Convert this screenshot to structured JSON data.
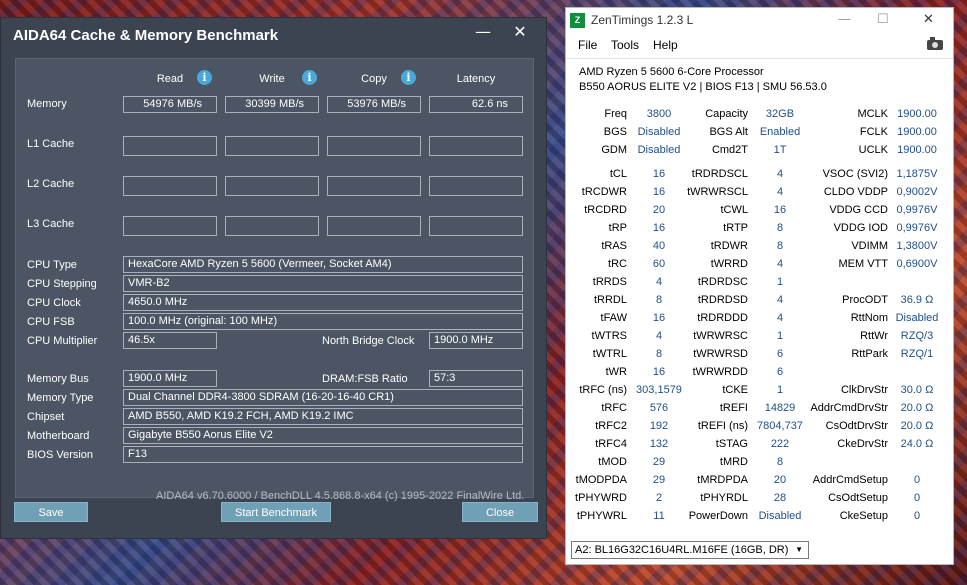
{
  "aida": {
    "title": "AIDA64 Cache & Memory Benchmark",
    "minimize_glyph": "—",
    "close_glyph": "✕",
    "columns": {
      "read": "Read",
      "write": "Write",
      "copy": "Copy",
      "latency": "Latency"
    },
    "info_glyph": "i",
    "rows": [
      {
        "label": "Memory",
        "read": "54976 MB/s",
        "write": "30399 MB/s",
        "copy": "53976 MB/s",
        "latency": "62.6 ns"
      },
      {
        "label": "L1 Cache",
        "read": "",
        "write": "",
        "copy": "",
        "latency": ""
      },
      {
        "label": "L2 Cache",
        "read": "",
        "write": "",
        "copy": "",
        "latency": ""
      },
      {
        "label": "L3 Cache",
        "read": "",
        "write": "",
        "copy": "",
        "latency": ""
      }
    ],
    "cpu": {
      "type_label": "CPU Type",
      "type": "HexaCore AMD Ryzen 5 5600  (Vermeer, Socket AM4)",
      "stepping_label": "CPU Stepping",
      "stepping": "VMR-B2",
      "clock_label": "CPU Clock",
      "clock": "4650.0 MHz",
      "fsb_label": "CPU FSB",
      "fsb": "100.0 MHz  (original: 100 MHz)",
      "mult_label": "CPU Multiplier",
      "mult": "46.5x",
      "nb_label": "North Bridge Clock",
      "nb": "1900.0 MHz"
    },
    "mem": {
      "bus_label": "Memory Bus",
      "bus": "1900.0 MHz",
      "ratio_label": "DRAM:FSB Ratio",
      "ratio": "57:3",
      "type_label": "Memory Type",
      "type": "Dual Channel DDR4-3800 SDRAM  (16-20-16-40 CR1)",
      "chipset_label": "Chipset",
      "chipset": "AMD B550, AMD K19.2 FCH, AMD K19.2 IMC",
      "mobo_label": "Motherboard",
      "mobo": "Gigabyte B550 Aorus Elite V2",
      "bios_label": "BIOS Version",
      "bios": "F13"
    },
    "footer": "AIDA64 v6.70.6000 / BenchDLL 4.5.868.8-x64  (c) 1995-2022 FinalWire Ltd.",
    "buttons": {
      "save": "Save",
      "start": "Start Benchmark",
      "close": "Close"
    }
  },
  "zen": {
    "title": "ZenTimings 1.2.3 L",
    "logo": "Z",
    "menu": {
      "file": "File",
      "tools": "Tools",
      "help": "Help"
    },
    "cpu": "AMD Ryzen 5 5600 6-Core Processor",
    "board": "B550 AORUS ELITE V2 | BIOS F13 | SMU 56.53.0",
    "top": [
      {
        "k1": "Freq",
        "v1": "3800",
        "k2": "Capacity",
        "v2": "32GB",
        "k3": "MCLK",
        "v3": "1900.00"
      },
      {
        "k1": "BGS",
        "v1": "Disabled",
        "k2": "BGS Alt",
        "v2": "Enabled",
        "k3": "FCLK",
        "v3": "1900.00"
      },
      {
        "k1": "GDM",
        "v1": "Disabled",
        "k2": "Cmd2T",
        "v2": "1T",
        "k3": "UCLK",
        "v3": "1900.00"
      }
    ],
    "timings": [
      {
        "k1": "tCL",
        "v1": "16",
        "k2": "tRDRDSCL",
        "v2": "4",
        "k3": "VSOC (SVI2)",
        "v3": "1,1875V"
      },
      {
        "k1": "tRCDWR",
        "v1": "16",
        "k2": "tWRWRSCL",
        "v2": "4",
        "k3": "CLDO VDDP",
        "v3": "0,9002V"
      },
      {
        "k1": "tRCDRD",
        "v1": "20",
        "k2": "tCWL",
        "v2": "16",
        "k3": "VDDG CCD",
        "v3": "0,9976V"
      },
      {
        "k1": "tRP",
        "v1": "16",
        "k2": "tRTP",
        "v2": "8",
        "k3": "VDDG IOD",
        "v3": "0,9976V"
      },
      {
        "k1": "tRAS",
        "v1": "40",
        "k2": "tRDWR",
        "v2": "8",
        "k3": "VDIMM",
        "v3": "1,3800V"
      },
      {
        "k1": "tRC",
        "v1": "60",
        "k2": "tWRRD",
        "v2": "4",
        "k3": "MEM VTT",
        "v3": "0,6900V"
      },
      {
        "k1": "tRRDS",
        "v1": "4",
        "k2": "tRDRDSC",
        "v2": "1",
        "k3": "",
        "v3": ""
      },
      {
        "k1": "tRRDL",
        "v1": "8",
        "k2": "tRDRDSD",
        "v2": "4",
        "k3": "ProcODT",
        "v3": "36.9 Ω"
      },
      {
        "k1": "tFAW",
        "v1": "16",
        "k2": "tRDRDDD",
        "v2": "4",
        "k3": "RttNom",
        "v3": "Disabled"
      },
      {
        "k1": "tWTRS",
        "v1": "4",
        "k2": "tWRWRSC",
        "v2": "1",
        "k3": "RttWr",
        "v3": "RZQ/3"
      },
      {
        "k1": "tWTRL",
        "v1": "8",
        "k2": "tWRWRSD",
        "v2": "6",
        "k3": "RttPark",
        "v3": "RZQ/1"
      },
      {
        "k1": "tWR",
        "v1": "16",
        "k2": "tWRWRDD",
        "v2": "6",
        "k3": "",
        "v3": ""
      },
      {
        "k1": "tRFC (ns)",
        "v1": "303,1579",
        "k2": "tCKE",
        "v2": "1",
        "k3": "ClkDrvStr",
        "v3": "30.0 Ω"
      },
      {
        "k1": "tRFC",
        "v1": "576",
        "k2": "tREFI",
        "v2": "14829",
        "k3": "AddrCmdDrvStr",
        "v3": "20.0 Ω"
      },
      {
        "k1": "tRFC2",
        "v1": "192",
        "k2": "tREFI (ns)",
        "v2": "7804,737",
        "k3": "CsOdtDrvStr",
        "v3": "20.0 Ω"
      },
      {
        "k1": "tRFC4",
        "v1": "132",
        "k2": "tSTAG",
        "v2": "222",
        "k3": "CkeDrvStr",
        "v3": "24.0 Ω"
      },
      {
        "k1": "tMOD",
        "v1": "29",
        "k2": "tMRD",
        "v2": "8",
        "k3": "",
        "v3": ""
      },
      {
        "k1": "tMODPDA",
        "v1": "29",
        "k2": "tMRDPDA",
        "v2": "20",
        "k3": "AddrCmdSetup",
        "v3": "0"
      },
      {
        "k1": "tPHYWRD",
        "v1": "2",
        "k2": "tPHYRDL",
        "v2": "28",
        "k3": "CsOdtSetup",
        "v3": "0"
      },
      {
        "k1": "tPHYWRL",
        "v1": "11",
        "k2": "PowerDown",
        "v2": "Disabled",
        "k3": "CkeSetup",
        "v3": "0"
      }
    ],
    "module": "A2: BL16G32C16U4RL.M16FE (16GB, DR)"
  }
}
